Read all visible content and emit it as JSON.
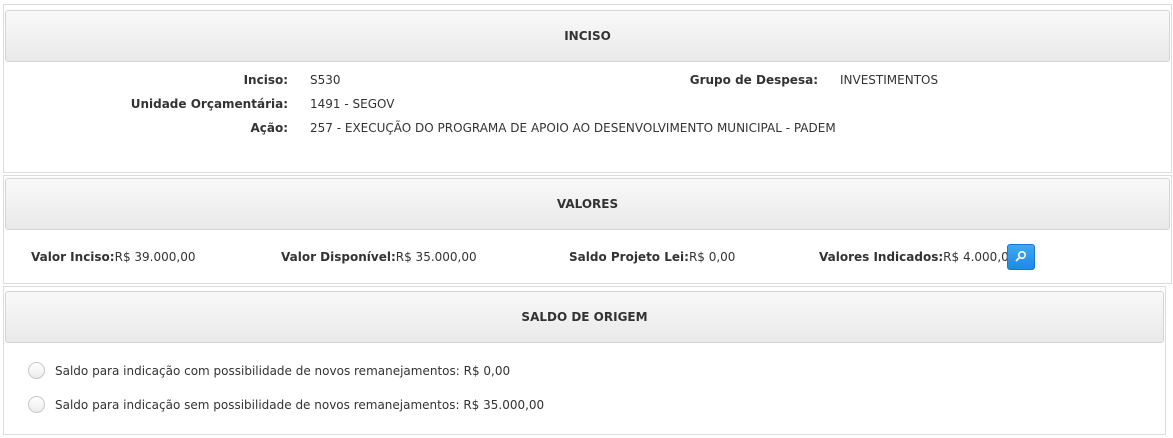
{
  "inciso_section": {
    "title": "INCISO",
    "inciso_label": "Inciso:",
    "inciso_value": "S530",
    "grupo_label": "Grupo de Despesa:",
    "grupo_value": "INVESTIMENTOS",
    "unidade_label": "Unidade Orçamentária:",
    "unidade_value": "1491 - SEGOV",
    "acao_label": "Ação:",
    "acao_value": "257 - EXECUÇÃO DO PROGRAMA DE APOIO AO DESENVOLVIMENTO MUNICIPAL - PADEM"
  },
  "valores_section": {
    "title": "VALORES",
    "valor_inciso_label": "Valor Inciso:",
    "valor_inciso_value": "R$ 39.000,00",
    "valor_disponivel_label": "Valor Disponível:",
    "valor_disponivel_value": "R$ 35.000,00",
    "saldo_projeto_label": "Saldo Projeto Lei:",
    "saldo_projeto_value": "R$ 0,00",
    "valores_indicados_label": "Valores Indicados:",
    "valores_indicados_value": "R$ 4.000,00",
    "search_icon": "search-icon"
  },
  "saldo_section": {
    "title": "SALDO DE ORIGEM",
    "option_com": "Saldo para indicação com possibilidade de novos remanejamentos: R$ 0,00",
    "option_sem": "Saldo para indicação sem possibilidade de novos remanejamentos: R$ 35.000,00"
  },
  "colors": {
    "header_bg": "#ececec",
    "button_blue": "#2196f3"
  }
}
